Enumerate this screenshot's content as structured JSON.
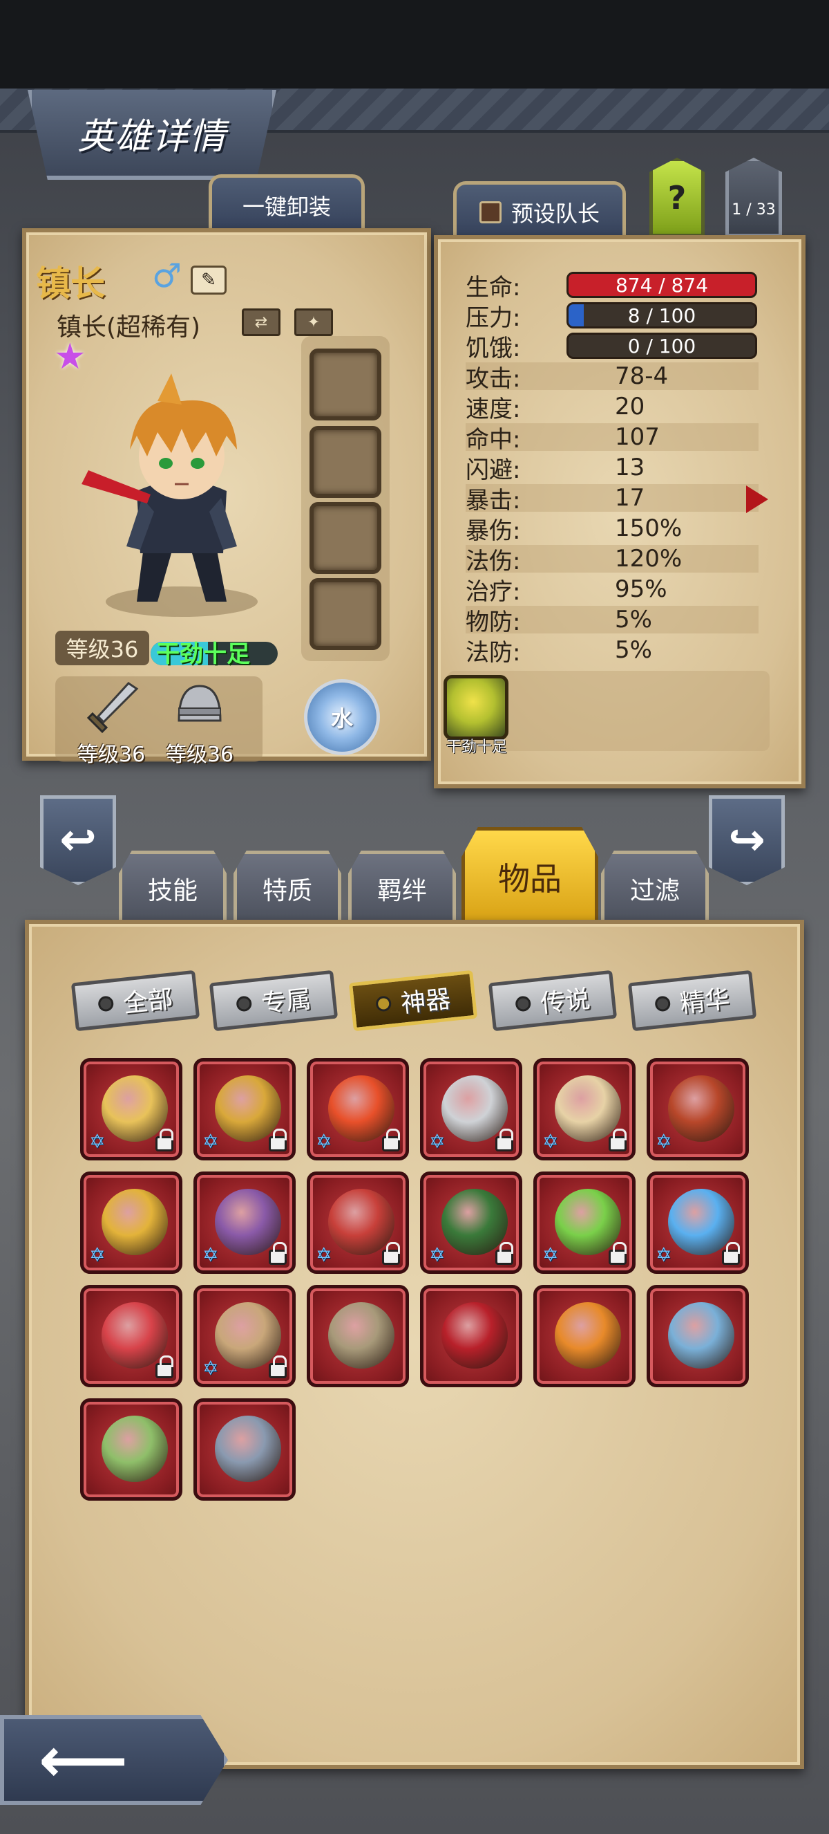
{
  "header": {
    "title": "英雄详情"
  },
  "top_buttons": {
    "unequip_all": "一键卸装",
    "preset_leader": "预设队长",
    "help": "?",
    "page_counter": "1 / 33"
  },
  "hero": {
    "name": "镇长",
    "rank": "镇长(超稀有)",
    "level": "等级36",
    "status_label": "干劲十足",
    "status_fill": 0.45,
    "element": "水",
    "gender_icon": "male-icon",
    "equipment": [
      {
        "icon": "sword-icon",
        "level": "等级36"
      },
      {
        "icon": "helmet-icon",
        "level": "等级36"
      }
    ]
  },
  "stats": {
    "bars": [
      {
        "label": "生命:",
        "value": "874 / 874",
        "fill": 1.0,
        "color": "#c8202a"
      },
      {
        "label": "压力:",
        "value": "8 / 100",
        "fill": 0.08,
        "color": "#2b63c8"
      },
      {
        "label": "饥饿:",
        "value": "0 / 100",
        "fill": 0.0,
        "color": "#7a5a2a"
      }
    ],
    "rows": [
      {
        "label": "攻击:",
        "value": "78-4"
      },
      {
        "label": "速度:",
        "value": "20"
      },
      {
        "label": "命中:",
        "value": "107"
      },
      {
        "label": "闪避:",
        "value": "13"
      },
      {
        "label": "暴击:",
        "value": "17"
      },
      {
        "label": "暴伤:",
        "value": "150%"
      },
      {
        "label": "法伤:",
        "value": "120%"
      },
      {
        "label": "治疗:",
        "value": "95%"
      },
      {
        "label": "物防:",
        "value": "5%"
      },
      {
        "label": "法防:",
        "value": "5%"
      }
    ],
    "trait": {
      "label": "干劲十足",
      "icon": "happy-face-trait-icon"
    }
  },
  "tabs": [
    {
      "label": "技能",
      "active": false
    },
    {
      "label": "特质",
      "active": false
    },
    {
      "label": "羁绊",
      "active": false
    },
    {
      "label": "物品",
      "active": true
    },
    {
      "label": "过滤",
      "active": false
    }
  ],
  "filters": [
    {
      "label": "全部",
      "active": false
    },
    {
      "label": "专属",
      "active": false
    },
    {
      "label": "神器",
      "active": true
    },
    {
      "label": "传说",
      "active": false
    },
    {
      "label": "精华",
      "active": false
    }
  ],
  "items": [
    {
      "icon": "golden-hood-icon",
      "color": "#e8c25a",
      "locked": true,
      "starred": true
    },
    {
      "icon": "winged-mace-icon",
      "color": "#d9a83a",
      "locked": true,
      "starred": true
    },
    {
      "icon": "fire-heart-icon",
      "color": "#e8502a",
      "locked": true,
      "starred": true
    },
    {
      "icon": "silver-ring-icon",
      "color": "#cfd2d6",
      "locked": true,
      "starred": true
    },
    {
      "icon": "horn-cup-icon",
      "color": "#e7d2a6",
      "locked": true,
      "starred": true
    },
    {
      "icon": "demon-helm-icon",
      "color": "#b8472a",
      "locked": false,
      "starred": true
    },
    {
      "icon": "gem-crown-icon",
      "color": "#e3b33a",
      "locked": false,
      "starred": true
    },
    {
      "icon": "witch-hat-icon",
      "color": "#8a5aa8",
      "locked": true,
      "starred": true
    },
    {
      "icon": "eye-scarf-icon",
      "color": "#c8403a",
      "locked": true,
      "starred": true
    },
    {
      "icon": "pirate-hat-icon",
      "color": "#3a7a3a",
      "locked": true,
      "starred": true
    },
    {
      "icon": "vine-whip-icon",
      "color": "#7ad04a",
      "locked": true,
      "starred": true
    },
    {
      "icon": "crystal-orb-icon",
      "color": "#5ab0f0",
      "locked": true,
      "starred": true
    },
    {
      "icon": "red-tome-icon",
      "color": "#d8434a",
      "locked": true,
      "starred": false
    },
    {
      "icon": "mantle-cloak-icon",
      "color": "#c9a77a",
      "locked": true,
      "starred": true
    },
    {
      "icon": "war-hammer-icon",
      "color": "#a89a7a",
      "locked": false,
      "starred": false
    },
    {
      "icon": "crimson-blade-icon",
      "color": "#b8202a",
      "locked": false,
      "starred": false
    },
    {
      "icon": "pumpkin-ring-icon",
      "color": "#e88a2a",
      "locked": false,
      "starred": false
    },
    {
      "icon": "steel-gauntlet-icon",
      "color": "#7ab0d8",
      "locked": false,
      "starred": false
    },
    {
      "icon": "green-dagger-icon",
      "color": "#8fbf6a",
      "locked": false,
      "starred": false
    },
    {
      "icon": "spiked-shield-icon",
      "color": "#8a9ab0",
      "locked": false,
      "starred": false
    }
  ],
  "nav": {
    "prev": "↩",
    "next": "↪",
    "back": "⟵"
  }
}
